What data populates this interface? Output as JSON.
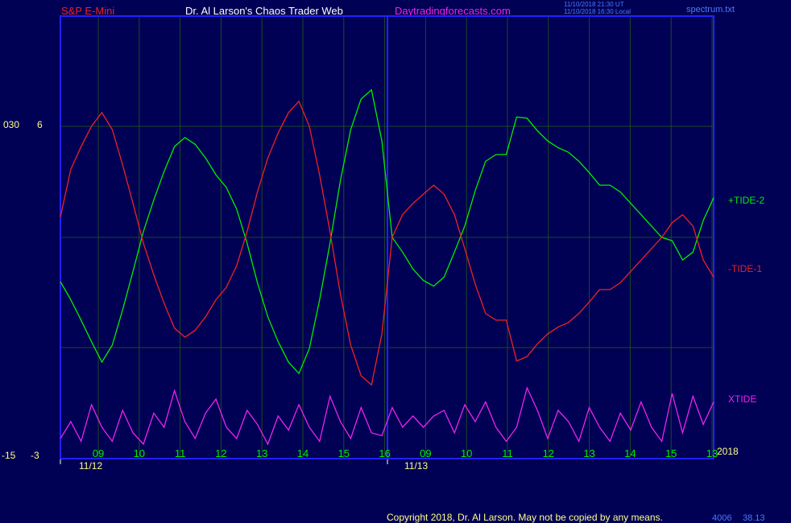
{
  "header": {
    "instrument": "S&P E-Mini",
    "site_title": "Dr. Al Larson's Chaos Trader Web",
    "website": "Daytradingforecasts.com",
    "ut_time": "11/10/2018 21:30 UT",
    "local_time": "11/10/2018 16:30 Local",
    "file_name": "spectrum.txt"
  },
  "footer": {
    "copyright": "Copyright 2018, Dr. Al Larson. May not be copied by any means.",
    "version": "4006",
    "version_right": "38.13"
  },
  "colors": {
    "background": "#000055",
    "plot_border": "#2222ff",
    "grid": "#1d4a1d",
    "plus_tide": "#00ee00",
    "minus_tide": "#ee2222",
    "xtide": "#ee22ee",
    "header_red": "#ee2222",
    "header_white": "#ffffff",
    "header_magenta": "#ee22ee",
    "tick_green": "#00ee00",
    "date_yellow": "#ffff88"
  },
  "chart_data": {
    "type": "line",
    "x_labels": [
      "09",
      "10",
      "11",
      "12",
      "13",
      "14",
      "15",
      "16",
      "09",
      "10",
      "11",
      "12",
      "13",
      "14",
      "15",
      "13"
    ],
    "date_labels": [
      "11/12",
      "11/13"
    ],
    "year_label": "2018",
    "upper_axis": {
      "label_left": "030",
      "label_right": "6"
    },
    "lower_axis": {
      "label_left": "-15",
      "label_right": "-3"
    },
    "series": [
      {
        "name": "+TIDE-2",
        "color": "#00ee00",
        "values": [
          -0.39,
          -0.55,
          -0.73,
          -0.92,
          -1.1,
          -0.95,
          -0.64,
          -0.3,
          0.05,
          0.33,
          0.58,
          0.8,
          0.88,
          0.82,
          0.7,
          0.55,
          0.44,
          0.25,
          -0.05,
          -0.4,
          -0.7,
          -0.92,
          -1.1,
          -1.2,
          -0.98,
          -0.55,
          -0.05,
          0.5,
          0.95,
          1.22,
          1.3,
          0.85,
          0.0,
          -0.13,
          -0.28,
          -0.38,
          -0.43,
          -0.35,
          -0.13,
          0.1,
          0.41,
          0.67,
          0.73,
          0.73,
          1.06,
          1.05,
          0.94,
          0.85,
          0.79,
          0.75,
          0.67,
          0.57,
          0.46,
          0.46,
          0.4,
          0.3,
          0.2,
          0.1,
          0.0,
          -0.03,
          -0.2,
          -0.13,
          0.15,
          0.35
        ]
      },
      {
        "name": "-TIDE-1",
        "color": "#ee2222",
        "values": [
          0.18,
          0.6,
          0.8,
          0.98,
          1.1,
          0.95,
          0.64,
          0.3,
          -0.05,
          -0.33,
          -0.58,
          -0.8,
          -0.88,
          -0.82,
          -0.7,
          -0.55,
          -0.44,
          -0.25,
          0.05,
          0.4,
          0.7,
          0.92,
          1.1,
          1.2,
          0.98,
          0.55,
          0.05,
          -0.5,
          -0.95,
          -1.22,
          -1.3,
          -0.85,
          0.0,
          0.2,
          0.3,
          0.38,
          0.46,
          0.38,
          0.2,
          -0.1,
          -0.41,
          -0.67,
          -0.73,
          -0.73,
          -1.09,
          -1.05,
          -0.94,
          -0.85,
          -0.79,
          -0.75,
          -0.67,
          -0.57,
          -0.46,
          -0.46,
          -0.4,
          -0.3,
          -0.2,
          -0.1,
          0.0,
          0.13,
          0.2,
          0.1,
          -0.2,
          -0.35
        ]
      },
      {
        "name": "XTIDE",
        "color": "#ee22ee",
        "values": [
          0.1,
          0.4,
          0.05,
          0.7,
          0.3,
          0.05,
          0.6,
          0.2,
          0.0,
          0.55,
          0.3,
          0.95,
          0.4,
          0.1,
          0.55,
          0.8,
          0.3,
          0.1,
          0.6,
          0.35,
          0.0,
          0.5,
          0.25,
          0.7,
          0.3,
          0.05,
          0.85,
          0.4,
          0.1,
          0.65,
          0.2,
          0.15,
          0.65,
          0.3,
          0.5,
          0.3,
          0.5,
          0.6,
          0.2,
          0.7,
          0.4,
          0.75,
          0.3,
          0.05,
          0.3,
          1.0,
          0.6,
          0.1,
          0.6,
          0.4,
          0.05,
          0.65,
          0.3,
          0.05,
          0.55,
          0.25,
          0.75,
          0.3,
          0.05,
          0.9,
          0.2,
          0.85,
          0.35,
          0.75
        ]
      }
    ],
    "legend": [
      "+TIDE-2",
      "-TIDE-1",
      "XTIDE"
    ]
  }
}
